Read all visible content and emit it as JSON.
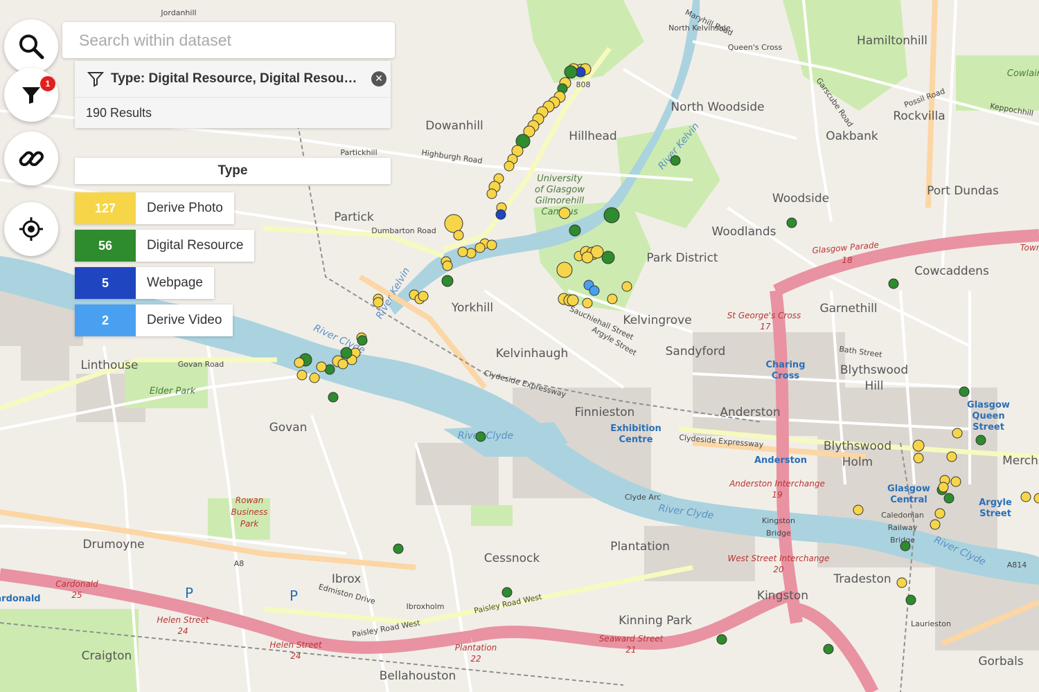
{
  "search": {
    "placeholder": "Search within dataset"
  },
  "filter": {
    "badge_count": "1",
    "label": "Type: Digital Resource, Digital Resou…",
    "results": "190 Results"
  },
  "legend": {
    "title": "Type",
    "items": [
      {
        "count": "127",
        "label": "Derive Photo",
        "color": "#f7d548"
      },
      {
        "count": "56",
        "label": "Digital Resource",
        "color": "#2e8b2e"
      },
      {
        "count": "5",
        "label": "Webpage",
        "color": "#1f45c0"
      },
      {
        "count": "2",
        "label": "Derive Video",
        "color": "#4aa0f0"
      }
    ]
  },
  "map_labels": {
    "north_kelvinside": "North Kelvinside",
    "queens_cross": "Queen's Cross",
    "hamiltonhill": "Hamiltonhill",
    "north_woodside": "North Woodside",
    "rockvilla": "Rockvilla",
    "oakbank": "Oakbank",
    "port_dundas": "Port Dundas",
    "dowanhill": "Dowanhill",
    "hillhead": "Hillhead",
    "partickhill": "Partickhill",
    "partick": "Partick",
    "woodside": "Woodside",
    "woodlands": "Woodlands",
    "park_district": "Park District",
    "cowcaddens": "Cowcaddens",
    "garnethill": "Garnethill",
    "yorkhill": "Yorkhill",
    "kelvingrove": "Kelvingrove",
    "kelvinhaugh": "Kelvinhaugh",
    "sandyford": "Sandyford",
    "blythswood_hill": "Blythswood",
    "hill": "Hill",
    "linthouse": "Linthouse",
    "govan": "Govan",
    "finnieston": "Finnieston",
    "anderston": "Anderston",
    "blythswood_holm": "Blythswood",
    "holm": "Holm",
    "drumoyne": "Drumoyne",
    "ibrox": "Ibrox",
    "cessnock": "Cessnock",
    "plantation": "Plantation",
    "kinning_park": "Kinning Park",
    "kingston": "Kingston",
    "tradeston": "Tradeston",
    "craigton": "Craigton",
    "bellahouston": "Bellahouston",
    "ibroxholm": "Ibroxholm",
    "laurieston": "Laurieston",
    "gorbals": "Gorbals",
    "jordanhill": "Jordanhill",
    "university": "University",
    "of_glasgow": "of Glasgow",
    "gilmorehill": "Gilmorehill",
    "campus": "Campus",
    "elder_park": "Elder Park",
    "rowan": "Rowan",
    "business": "Business",
    "park": "Park",
    "cowlair": "Cowlair",
    "river_clyde": "River Clyde",
    "river_kelvin": "River Kelvin",
    "glasgow_parade": "Glasgow Parade",
    "st_georges_cross": "St George's Cross",
    "charing": "Charing",
    "cross": "Cross",
    "exhibition": "Exhibition",
    "centre": "Centre",
    "anderston_stn": "Anderston",
    "anderston_interchange": "Anderston Interchange",
    "west_street_interchange": "West Street Interchange",
    "glasgow": "Glasgow",
    "central": "Central",
    "queen": "Queen",
    "street": "Street",
    "argyle": "Argyle",
    "caledonian": "Caledonian",
    "railway": "Railway",
    "bridge": "Bridge",
    "kingston_bridge": "Kingston",
    "bridge2": "Bridge",
    "clyde_arc": "Clyde Arc",
    "cardonald": "Cardonald",
    "ardonald": "ardonald",
    "helen_street": "Helen Street",
    "seaward_street": "Seaward Street",
    "plantation_rd": "Plantation",
    "paisley_road_west": "Paisley Road West",
    "edmiston_drive": "Edmiston Drive",
    "clydeside_expressway": "Clydeside Expressway",
    "dumbarton_road": "Dumbarton Road",
    "govan_road": "Govan Road",
    "sauchiehall_street": "Sauchiehall Street",
    "argyle_street": "Argyle Street",
    "bath_street": "Bath Street",
    "highburgh_road": "Highburgh Road",
    "maryhill_road": "Maryhill Road",
    "possil_road": "Possil Road",
    "keppochhill": "Keppochhill",
    "garscube_road": "Garscube Road",
    "a8": "A8",
    "a814": "A814",
    "a808": "808",
    "num18": "18",
    "num17": "17",
    "num19": "19",
    "num20": "20",
    "num21": "21",
    "num22": "22",
    "num24": "24",
    "num25": "25",
    "merch": "Merch",
    "town": "Town"
  }
}
